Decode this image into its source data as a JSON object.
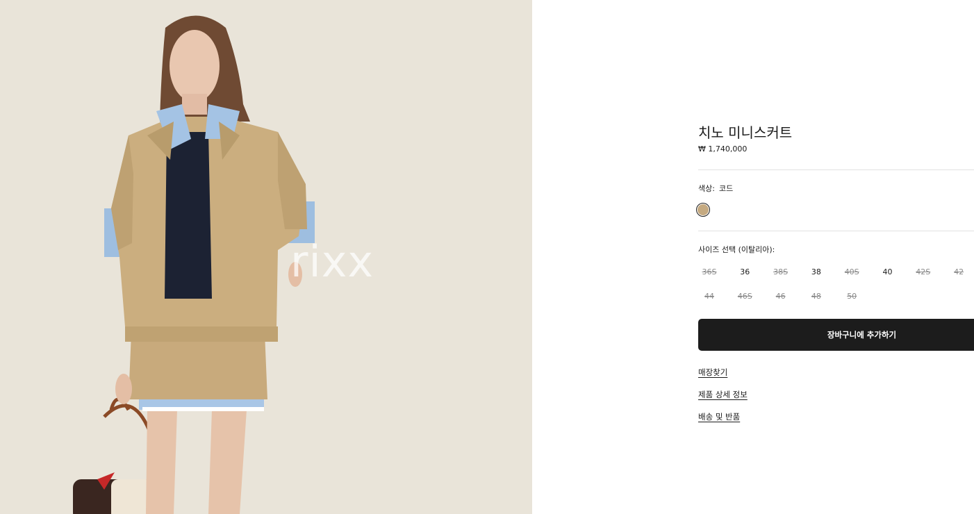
{
  "product": {
    "name": "치노 미니스커트",
    "price": "₩ 1,740,000"
  },
  "photo": {
    "watermark": "rixx"
  },
  "color": {
    "label": "색상:",
    "value": "코드",
    "swatch_color": "#c5aa81"
  },
  "size": {
    "label": "사이즈 선택 (이탈리아):",
    "rows": [
      [
        {
          "label": "36S",
          "available": false
        },
        {
          "label": "36",
          "available": true
        },
        {
          "label": "38S",
          "available": false
        },
        {
          "label": "38",
          "available": true
        },
        {
          "label": "40S",
          "available": false
        },
        {
          "label": "40",
          "available": true
        },
        {
          "label": "42S",
          "available": false
        },
        {
          "label": "42",
          "available": false
        }
      ],
      [
        {
          "label": "44",
          "available": false
        },
        {
          "label": "46S",
          "available": false
        },
        {
          "label": "46",
          "available": false
        },
        {
          "label": "48",
          "available": false
        },
        {
          "label": "50",
          "available": false
        }
      ]
    ]
  },
  "actions": {
    "add_to_cart": "장바구니에 추가하기"
  },
  "links": {
    "find_store": "매장찾기",
    "product_details": "제품 상세 정보",
    "shipping_returns": "배송 및 반품"
  }
}
